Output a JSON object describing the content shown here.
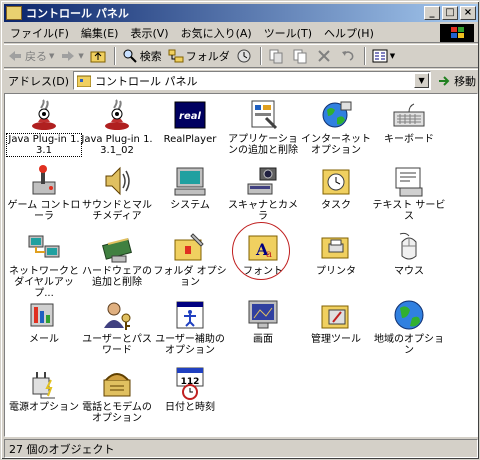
{
  "window": {
    "title": "コントロール パネル"
  },
  "menu": [
    "ファイル(F)",
    "編集(E)",
    "表示(V)",
    "お気に入り(A)",
    "ツール(T)",
    "ヘルプ(H)"
  ],
  "toolbar": {
    "back": "戻る",
    "search": "検索",
    "folders": "フォルダ"
  },
  "address": {
    "label": "アドレス(D)",
    "value": "コントロール パネル",
    "go": "移動"
  },
  "items": [
    {
      "label": "Java Plug-in 1.3.1",
      "icon": "java-icon"
    },
    {
      "label": "Java Plug-in 1.3.1_02",
      "icon": "java-icon"
    },
    {
      "label": "RealPlayer",
      "icon": "realplayer-icon"
    },
    {
      "label": "アプリケーションの追加と削除",
      "icon": "add-remove-programs-icon"
    },
    {
      "label": "インターネット オプション",
      "icon": "internet-options-icon"
    },
    {
      "label": "キーボード",
      "icon": "keyboard-icon"
    },
    {
      "label": "ゲーム コントローラ",
      "icon": "game-controller-icon"
    },
    {
      "label": "サウンドとマルチメディア",
      "icon": "sound-icon"
    },
    {
      "label": "システム",
      "icon": "system-icon"
    },
    {
      "label": "スキャナとカメラ",
      "icon": "scanner-camera-icon"
    },
    {
      "label": "タスク",
      "icon": "task-icon"
    },
    {
      "label": "テキスト サービス",
      "icon": "text-services-icon"
    },
    {
      "label": "ネットワークとダイヤルアップ...",
      "icon": "network-icon"
    },
    {
      "label": "ハードウェアの追加と削除",
      "icon": "hardware-icon"
    },
    {
      "label": "フォルダ オプション",
      "icon": "folder-options-icon"
    },
    {
      "label": "フォント",
      "icon": "fonts-icon"
    },
    {
      "label": "プリンタ",
      "icon": "printer-icon"
    },
    {
      "label": "マウス",
      "icon": "mouse-icon"
    },
    {
      "label": "メール",
      "icon": "mail-icon"
    },
    {
      "label": "ユーザーとパスワード",
      "icon": "users-icon"
    },
    {
      "label": "ユーザー補助のオプション",
      "icon": "accessibility-icon"
    },
    {
      "label": "画面",
      "icon": "display-icon"
    },
    {
      "label": "管理ツール",
      "icon": "admin-tools-icon"
    },
    {
      "label": "地域のオプション",
      "icon": "regional-icon"
    },
    {
      "label": "電源オプション",
      "icon": "power-icon"
    },
    {
      "label": "電話とモデムのオプション",
      "icon": "phone-modem-icon"
    },
    {
      "label": "日付と時刻",
      "icon": "date-time-icon"
    }
  ],
  "status": {
    "text": "27 個のオブジェクト"
  }
}
